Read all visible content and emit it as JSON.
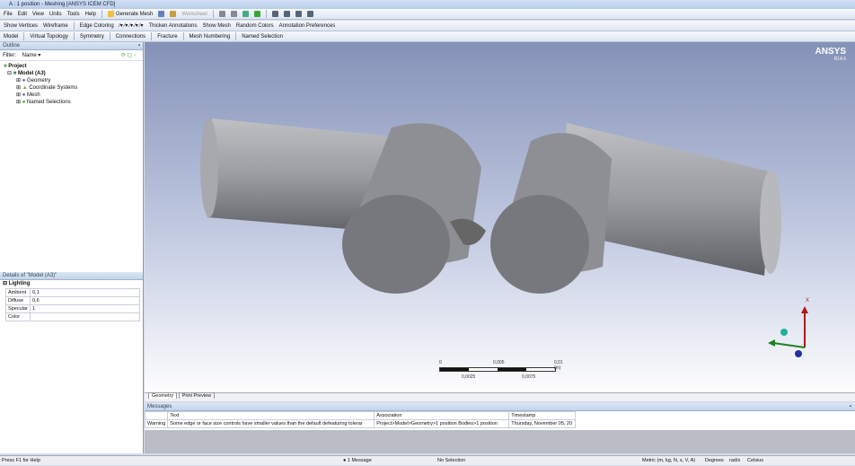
{
  "title": "A : 1 position - Meshing [ANSYS ICEM CFD]",
  "menu": [
    "File",
    "Edit",
    "View",
    "Units",
    "Tools",
    "Help"
  ],
  "toolbar1": {
    "generate_mesh": "Generate Mesh",
    "worksheet": "Worksheet"
  },
  "toolbar2": {
    "show_vertices": "Show Vertices",
    "wireframe": "Wireframe",
    "edge_coloring": "Edge Coloring",
    "thicken": "Thicken Annotations",
    "show_mesh": "Show Mesh",
    "random_colors": "Random Colors",
    "annotation_prefs": "Annotation Preferences"
  },
  "toolbar3": [
    "Model",
    "Virtual Topology",
    "Symmetry",
    "Connections",
    "Fracture",
    "Mesh Numbering",
    "Named Selection"
  ],
  "outline": {
    "title": "Outline",
    "filter_label": "Filter:",
    "filter_value": "Name",
    "project": "Project",
    "model": "Model (A3)",
    "children": [
      "Geometry",
      "Coordinate Systems",
      "Mesh",
      "Named Selections"
    ]
  },
  "details": {
    "title": "Details of \"Model (A3)\"",
    "group": "Lighting",
    "rows": [
      {
        "k": "Ambient",
        "v": "0,1"
      },
      {
        "k": "Diffuse",
        "v": "0,6"
      },
      {
        "k": "Specular",
        "v": "1"
      },
      {
        "k": "Color",
        "v": ""
      }
    ]
  },
  "viewport": {
    "brand": "ANSYS",
    "version": "R14.5",
    "scale": {
      "top": [
        "0",
        "0,005",
        "0,01 (m)"
      ],
      "bottom": [
        "0,0025",
        "0,0075"
      ]
    },
    "axis_x": "X"
  },
  "tabs": [
    "Geometry",
    "Print Preview"
  ],
  "messages": {
    "title": "Messages",
    "headers": [
      "Text",
      "Association",
      "Timestamp"
    ],
    "row": {
      "type": "Warning",
      "text": "Some edge or face size controls have smaller values than the default defeaturing tolerar",
      "assoc": "Project>Model>Geometry>1 position Bodies>1 position",
      "time": "Thursday, November 05, 20"
    }
  },
  "status": {
    "help": "Press F1 for Help",
    "messages": "1 Message",
    "selection": "No Selection",
    "units": "Metric (m, kg, N, s, V, A)",
    "angle": "Degrees",
    "rate": "rad/s",
    "temp": "Celsius"
  }
}
